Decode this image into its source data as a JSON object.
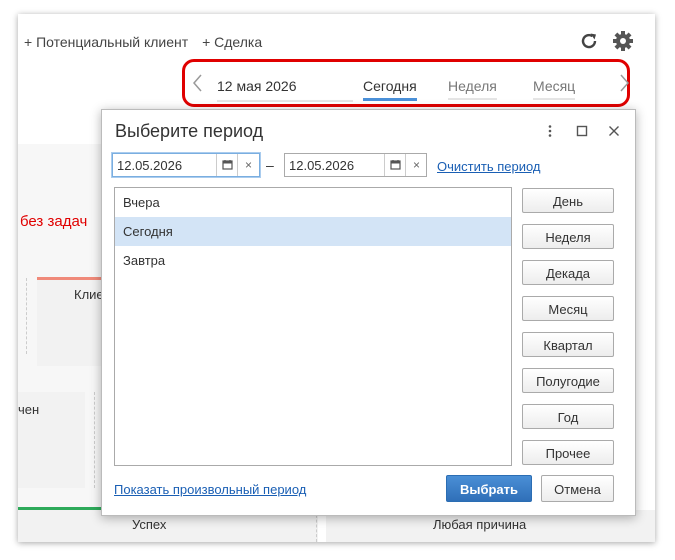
{
  "header": {
    "add_lead": "+ Потенциальный клиент",
    "add_deal": "+ Сделка"
  },
  "period_bar": {
    "date": "12 мая 2026",
    "tabs": [
      {
        "label": "Сегодня",
        "active": true
      },
      {
        "label": "Неделя",
        "active": false
      },
      {
        "label": "Месяц",
        "active": false
      }
    ]
  },
  "background": {
    "no_tasks": "без задач",
    "client_fragment": "Клие",
    "fragment_2": "чен",
    "success": "Успех",
    "any_reason": "Любая причина"
  },
  "dialog": {
    "title": "Выберите период",
    "date_from": "12.05.2026",
    "date_to": "12.05.2026",
    "separator": "–",
    "clear_link": "Очистить период",
    "list_items": [
      {
        "label": "Вчера",
        "selected": false
      },
      {
        "label": "Сегодня",
        "selected": true
      },
      {
        "label": "Завтра",
        "selected": false
      }
    ],
    "period_buttons": [
      "День",
      "Неделя",
      "Декада",
      "Месяц",
      "Квартал",
      "Полугодие",
      "Год",
      "Прочее"
    ],
    "custom_link": "Показать произвольный период",
    "ok_label": "Выбрать",
    "cancel_label": "Отмена"
  },
  "colors": {
    "accent": "#4a90d9",
    "highlight": "#e00000",
    "selected_row": "#d3e4f6",
    "primary_button": "#2f6fb8"
  }
}
